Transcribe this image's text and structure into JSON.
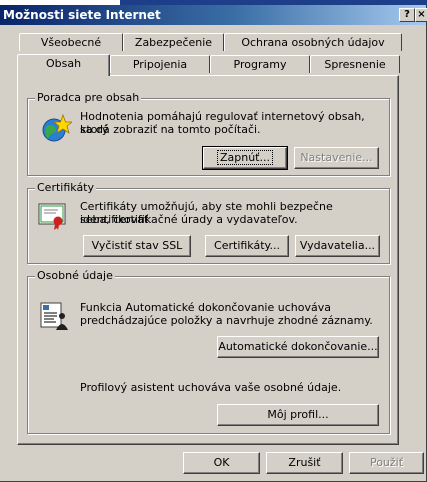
{
  "window": {
    "title": "Možnosti siete Internet",
    "help_glyph": "?",
    "close_glyph": "×"
  },
  "tabs": {
    "row1": [
      "Všeobecné",
      "Zabezpečenie",
      "Ochrana osobných údajov"
    ],
    "row2": [
      "Obsah",
      "Pripojenia",
      "Programy",
      "Spresnenie"
    ],
    "active": "Obsah"
  },
  "content_advisor": {
    "legend": "Poradca pre obsah",
    "description_line1": "Hodnotenia pomáhajú regulovať internetový obsah, ktorý",
    "description_line2": "sa dá zobraziť na tomto počítači.",
    "enable_button": "Zapnúť...",
    "settings_button": "Nastavenie...",
    "icon": "globe-star-icon"
  },
  "certificates": {
    "legend": "Certifikáty",
    "description_line1": "Certifikáty umožňujú, aby ste mohli bezpečne identifikovať",
    "description_line2": "seba, certifikačné úrady a vydavateľov.",
    "clear_ssl_button": "Vyčistiť stav SSL",
    "certificates_button": "Certifikáty...",
    "publishers_button": "Vydavatelia...",
    "icon": "certificate-icon"
  },
  "personal_info": {
    "legend": "Osobné údaje",
    "description_line1": "Funkcia Automatické dokončovanie uchováva",
    "description_line2": "predchádzajúce položky a navrhuje zhodné záznamy.",
    "autocomplete_button": "Automatické dokončovanie...",
    "profile_description": "Profilový asistent uchováva vaše osobné údaje.",
    "profile_button": "Môj profil...",
    "icon": "profile-card-icon"
  },
  "footer": {
    "ok_button": "OK",
    "cancel_button": "Zrušiť",
    "apply_button": "Použiť"
  }
}
